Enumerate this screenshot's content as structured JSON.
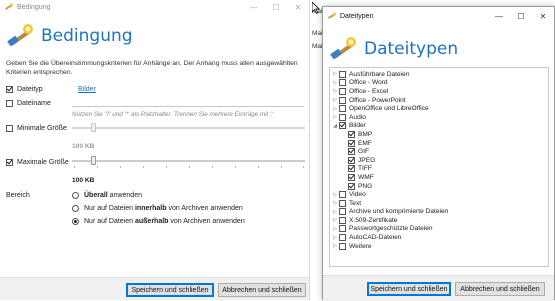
{
  "window1": {
    "title": "Bedingung",
    "header_title": "Bedingung",
    "description": "Geben Sie die Übereinstimmungskriterien für Anhänge an. Der Anhang muss allen ausgewählten Kriterien entsprechen.",
    "rows": {
      "dateityp": {
        "label": "Dateityp",
        "checked": true,
        "link": "Bilder"
      },
      "dateiname": {
        "label": "Dateiname",
        "checked": false,
        "placeholder": "Nutzen Sie '?' und '*' als Platzhalter. Trennen Sie mehrere Einträge mit ';'"
      },
      "min_size": {
        "label": "Minimale Größe",
        "checked": false,
        "value": "100 KB",
        "level": 0.09
      },
      "max_size": {
        "label": "Maximale Größe",
        "checked": true,
        "value": "100 KB",
        "level": 0.09
      }
    },
    "bereich": {
      "label": "Bereich",
      "options": [
        {
          "bold": "Überall",
          "pre": "",
          "post": " anwenden",
          "checked": false
        },
        {
          "pre": "Nur auf Dateien ",
          "bold": "innerhalb",
          "post": " von Archiven anwenden",
          "checked": false
        },
        {
          "pre": "Nur auf Dateien ",
          "bold": "außerhalb",
          "post": " von Archiven anwenden",
          "checked": true
        }
      ]
    },
    "buttons": {
      "save": "Speichern und schließen",
      "cancel": "Abbrechen und schließen"
    }
  },
  "background_text": [
    "Mai",
    "Mai",
    "Mai"
  ],
  "window2": {
    "title": "Dateitypen",
    "header_title": "Dateitypen",
    "tree": [
      {
        "label": "Ausführbare Dateien",
        "checked": false,
        "level": 0,
        "expander": true
      },
      {
        "label": "Office - Word",
        "checked": false,
        "level": 0,
        "expander": true
      },
      {
        "label": "Office - Excel",
        "checked": false,
        "level": 0,
        "expander": true
      },
      {
        "label": "Office - PowerPoint",
        "checked": false,
        "level": 0,
        "expander": true
      },
      {
        "label": "OpenOffice und LibreOffice",
        "checked": false,
        "level": 0,
        "expander": true
      },
      {
        "label": "Audio",
        "checked": false,
        "level": 0,
        "expander": true
      },
      {
        "label": "Bilder",
        "checked": true,
        "level": 0,
        "expander": true,
        "expanded": true
      },
      {
        "label": "BMP",
        "checked": true,
        "level": 1,
        "expander": false
      },
      {
        "label": "EMF",
        "checked": true,
        "level": 1,
        "expander": false
      },
      {
        "label": "GIF",
        "checked": true,
        "level": 1,
        "expander": false
      },
      {
        "label": "JPEG",
        "checked": true,
        "level": 1,
        "expander": false
      },
      {
        "label": "TIFF",
        "checked": true,
        "level": 1,
        "expander": false
      },
      {
        "label": "WMF",
        "checked": true,
        "level": 1,
        "expander": false
      },
      {
        "label": "PNG",
        "checked": true,
        "level": 1,
        "expander": false
      },
      {
        "label": "Video",
        "checked": false,
        "level": 0,
        "expander": true
      },
      {
        "label": "Text",
        "checked": false,
        "level": 0,
        "expander": true
      },
      {
        "label": "Archive und komprimierte Dateien",
        "checked": false,
        "level": 0,
        "expander": true
      },
      {
        "label": "X.509-Zertifikate",
        "checked": false,
        "level": 0,
        "expander": true
      },
      {
        "label": "Passwortgeschützte Dateien",
        "checked": false,
        "level": 0,
        "expander": true
      },
      {
        "label": "AutoCAD-Dateien",
        "checked": false,
        "level": 0,
        "expander": true
      },
      {
        "label": "Weitere",
        "checked": false,
        "level": 0,
        "expander": true
      }
    ],
    "buttons": {
      "save": "Speichern und schließen",
      "cancel": "Abbrechen und schließen"
    }
  },
  "icons": {
    "minimize": "minimize-icon",
    "maximize": "maximize-icon",
    "close": "close-icon",
    "app": "wand-icon"
  },
  "colors": {
    "accent": "#1e73be",
    "footer": "#f0f0f0"
  }
}
